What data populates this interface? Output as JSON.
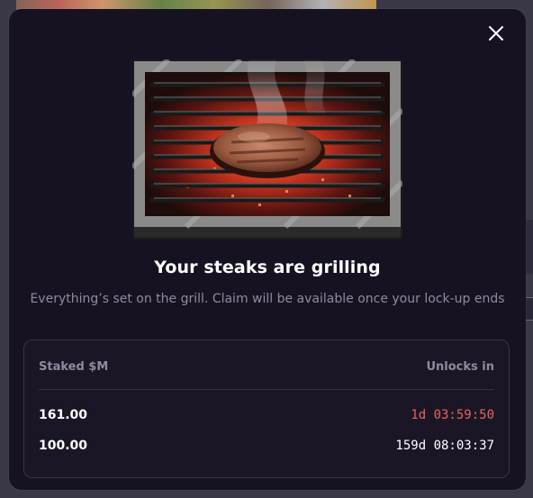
{
  "modal": {
    "title": "Your steaks are grilling",
    "subtitle": "Everything’s set on the grill. Claim will be available once your lock-up ends",
    "close_icon": "close-icon",
    "image_icon": "grill-steak-illustration"
  },
  "table": {
    "col_staked": "Staked $M",
    "col_unlocks": "Unlocks in",
    "rows": [
      {
        "amount": "161.00",
        "unlocks_in": "1d 03:59:50",
        "color": "#e8645a"
      },
      {
        "amount": "100.00",
        "unlocks_in": "159d 08:03:37",
        "color": "#ffffff"
      }
    ]
  },
  "colors": {
    "modal_bg": "#161222",
    "accent_red": "#e8645a",
    "muted_text": "#8f8aa0"
  }
}
